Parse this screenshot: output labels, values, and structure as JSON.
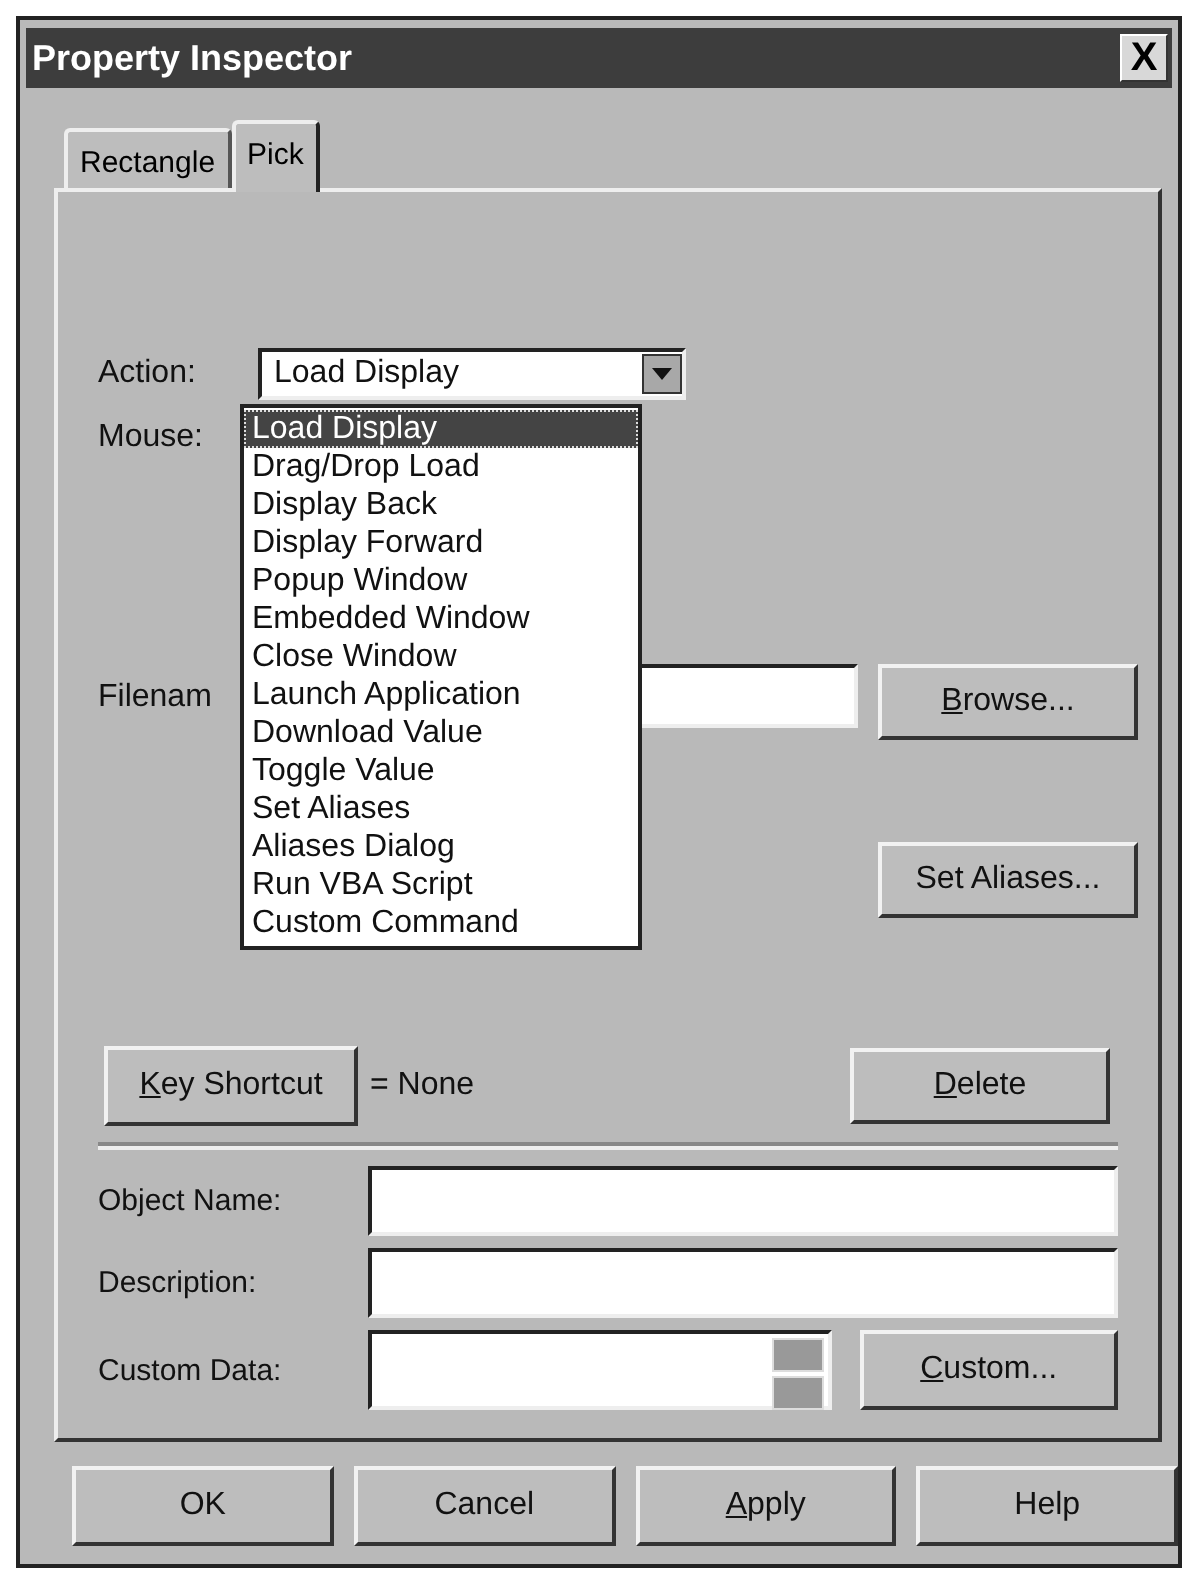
{
  "window": {
    "title": "Property Inspector",
    "close": "X"
  },
  "tabs": [
    {
      "label": "Rectangle",
      "selected": false
    },
    {
      "label": "Pick",
      "selected": true
    }
  ],
  "action": {
    "label": "Action:",
    "value": "Load Display",
    "expanded": true,
    "options": [
      {
        "label": "Load Display",
        "selected": true
      },
      {
        "label": "Drag/Drop Load",
        "selected": false
      },
      {
        "label": "Display Back",
        "selected": false
      },
      {
        "label": "Display Forward",
        "selected": false
      },
      {
        "label": "Popup Window",
        "selected": false
      },
      {
        "label": "Embedded Window",
        "selected": false
      },
      {
        "label": "Close Window",
        "selected": false
      },
      {
        "label": "Launch Application",
        "selected": false
      },
      {
        "label": "Download Value",
        "selected": false
      },
      {
        "label": "Toggle Value",
        "selected": false
      },
      {
        "label": "Set Aliases",
        "selected": false
      },
      {
        "label": "Aliases Dialog",
        "selected": false
      },
      {
        "label": "Run VBA Script",
        "selected": false
      },
      {
        "label": "Custom Command",
        "selected": false
      }
    ]
  },
  "mouse": {
    "label": "Mouse:"
  },
  "filename": {
    "label": "Filenam",
    "button": {
      "label": "Browse...",
      "underline_first": true
    }
  },
  "set_aliases_button": {
    "label": "Set Aliases...",
    "underline_first": false
  },
  "key_shortcut": {
    "button": {
      "label": "Key Shortcut",
      "underline_first": true
    },
    "value": "= None"
  },
  "delete_button": {
    "label": "Delete",
    "underline_first": true
  },
  "fields": [
    {
      "kind": "text",
      "label": "Object Name:"
    },
    {
      "kind": "text",
      "label": "Description:"
    },
    {
      "kind": "spin",
      "label": "Custom Data:",
      "button": {
        "label": "Custom...",
        "underline_first": true
      }
    }
  ],
  "buttons": [
    {
      "label": "OK",
      "underline_first": false
    },
    {
      "label": "Cancel",
      "underline_first": false
    },
    {
      "label": "Apply",
      "underline_first": true
    },
    {
      "label": "Help",
      "underline_first": false
    }
  ]
}
